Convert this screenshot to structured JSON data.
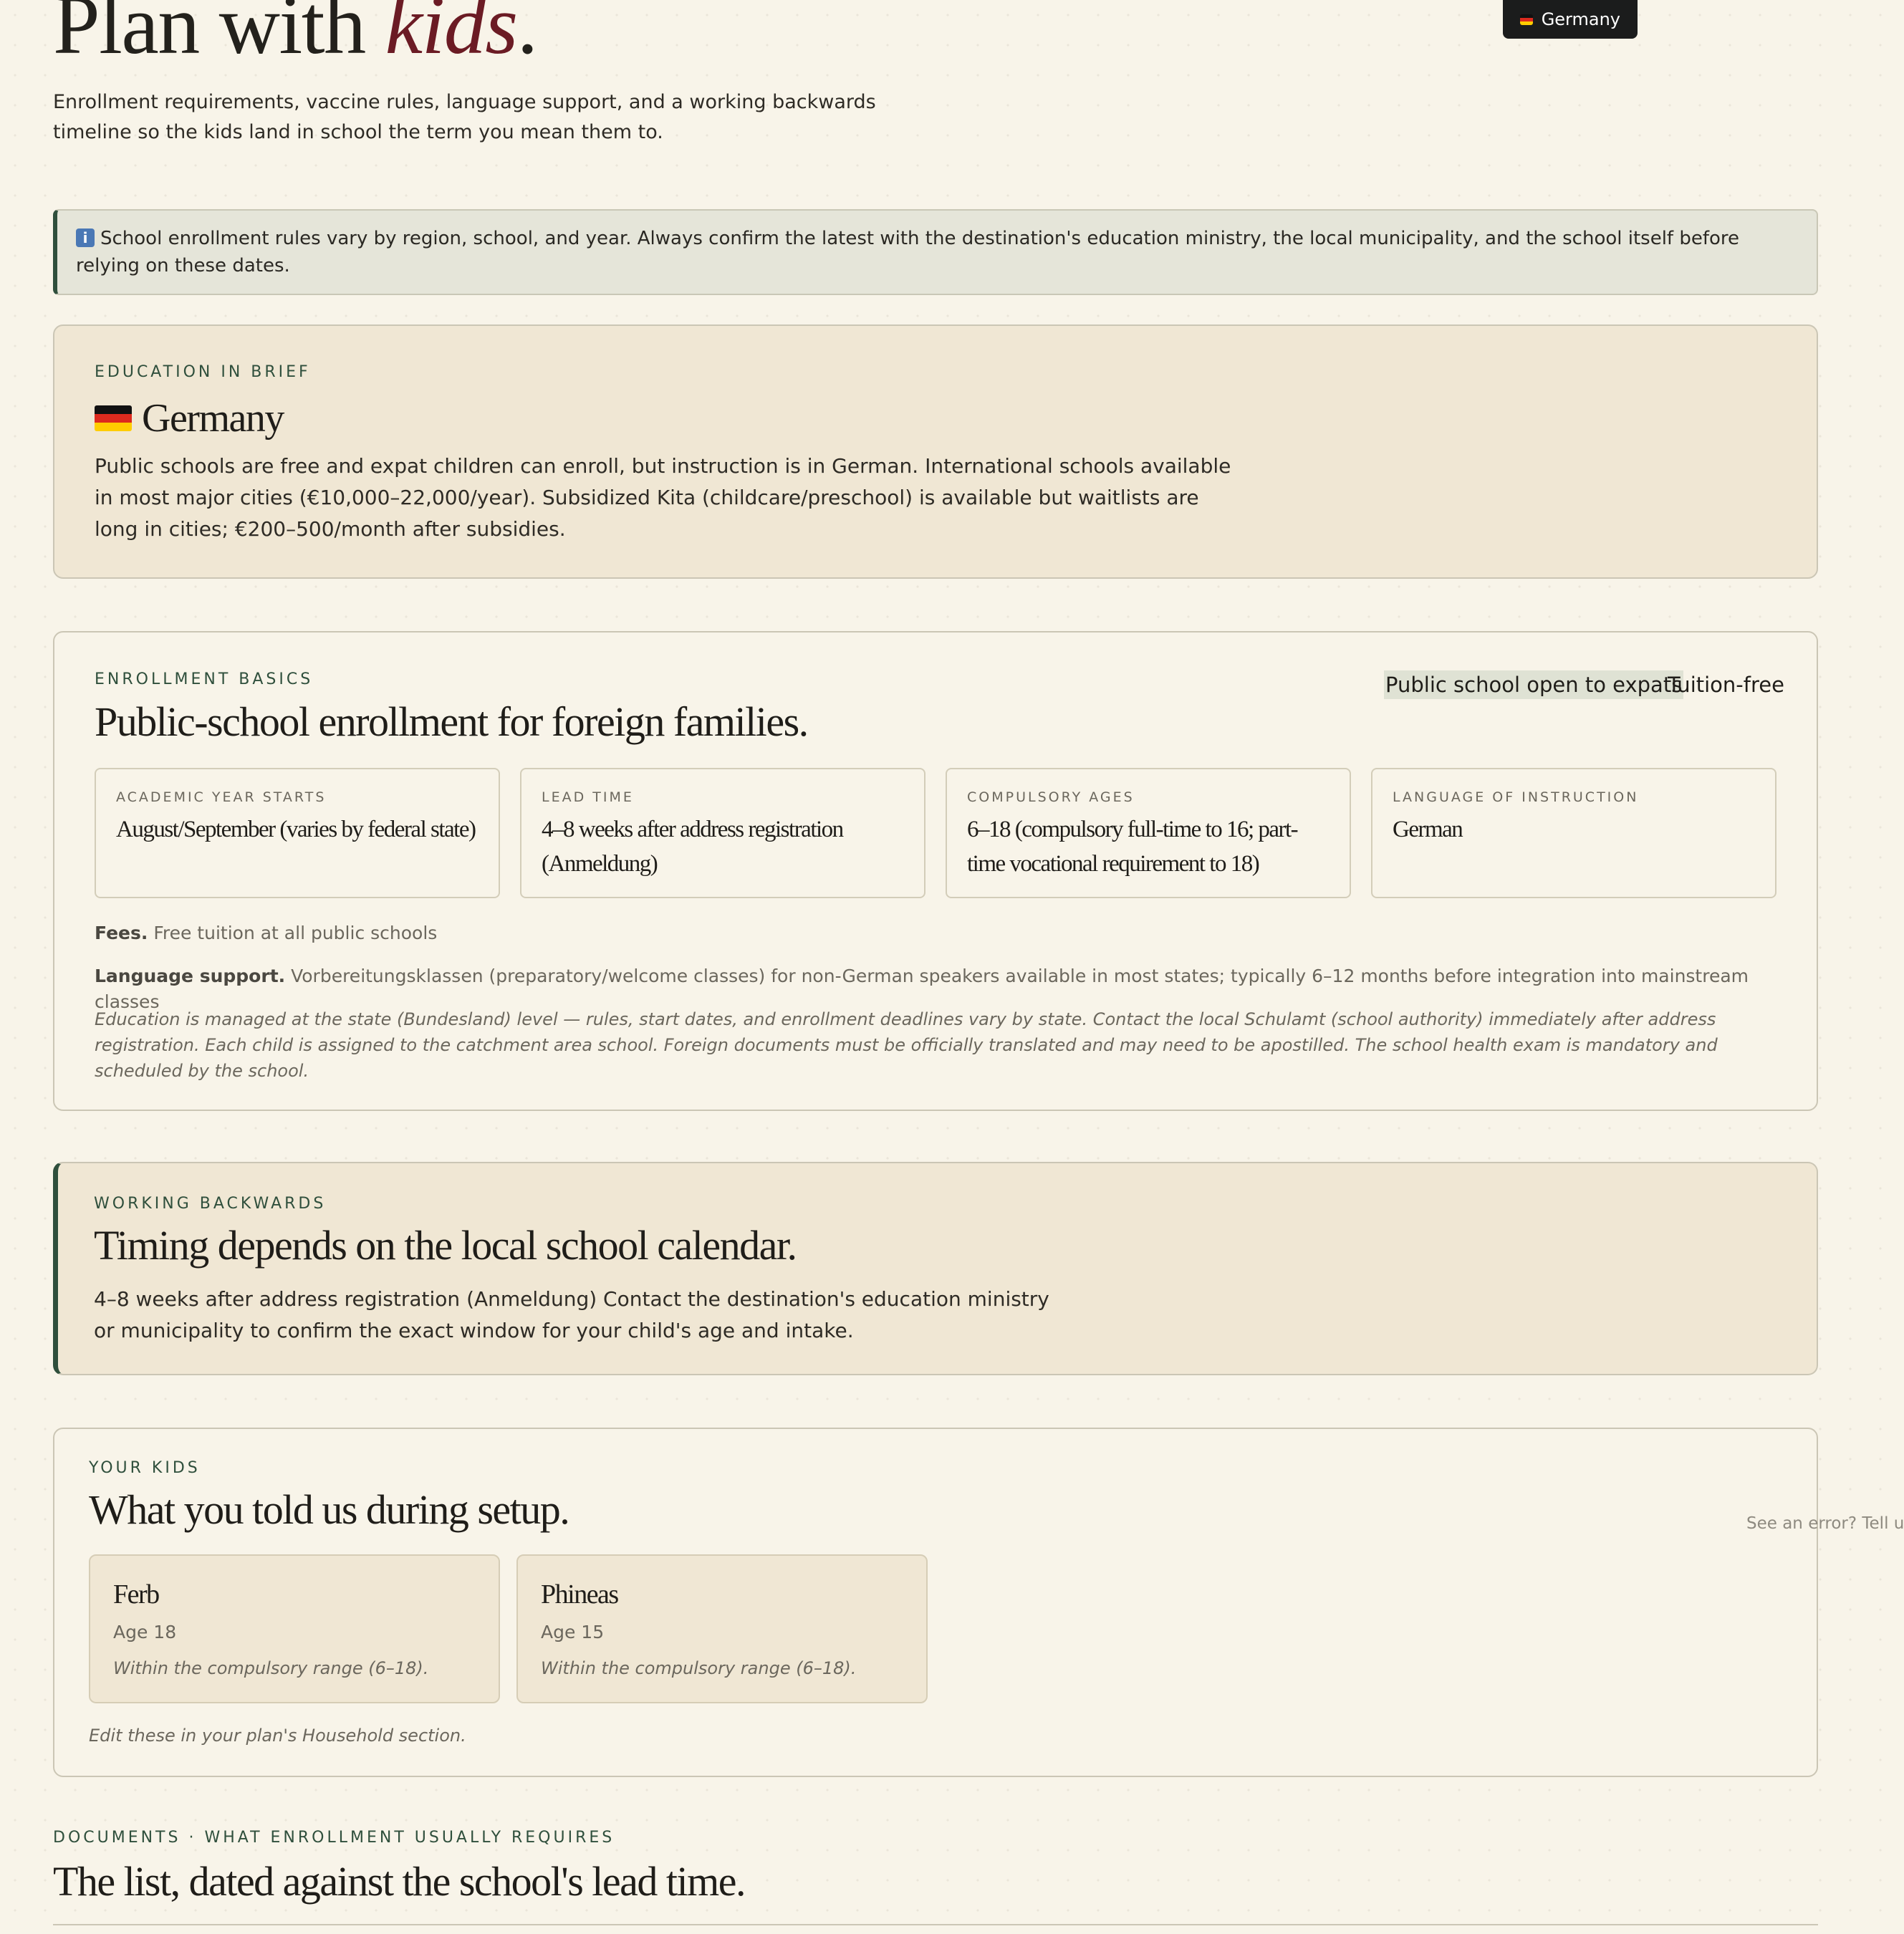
{
  "header": {
    "title_plain": "Plan with",
    "title_accent": "kids",
    "title_end": ".",
    "lede": "Enrollment requirements, vaccine rules, language support, and a working backwards timeline so the kids land in school the term you mean them to.",
    "country_selector": {
      "label": "Germany",
      "flag_icon": "germany-flag-icon"
    }
  },
  "notice": {
    "icon": "info-icon",
    "icon_glyph": "i",
    "text": "School enrollment rules vary by region, school, and year. Always confirm the latest with the destination's education ministry, the local municipality, and the school itself before relying on these dates."
  },
  "brief": {
    "eyebrow": "EDUCATION IN BRIEF",
    "country": "Germany",
    "body": "Public schools are free and expat children can enroll, but instruction is in German. International schools available in most major cities (€10,000–22,000/year). Subsidized Kita (childcare/preschool) is available but waitlists are long in cities; €200–500/month after subsidies."
  },
  "enrollment": {
    "eyebrow": "ENROLLMENT BASICS",
    "title": "Public-school enrollment for foreign families.",
    "tags": [
      "Public school open to expats",
      "Tuition-free"
    ],
    "stats": [
      {
        "label": "ACADEMIC YEAR STARTS",
        "value": "August/September (varies by federal state)"
      },
      {
        "label": "LEAD TIME",
        "value": "4–8 weeks after address registration (Anmeldung)"
      },
      {
        "label": "COMPULSORY AGES",
        "value": "6–18 (compulsory full-time to 16; part-time vocational requirement to 18)"
      },
      {
        "label": "LANGUAGE OF INSTRUCTION",
        "value": "German"
      }
    ],
    "fees_label": "Fees.",
    "fees_text": "Free tuition at all public schools",
    "language_label": "Language support.",
    "language_text": "Vorbereitungsklassen (preparatory/welcome classes) for non-German speakers available in most states; typically 6–12 months before integration into mainstream classes",
    "note": "Education is managed at the state (Bundesland) level — rules, start dates, and enrollment deadlines vary by state. Contact the local Schulamt (school authority) immediately after address registration. Each child is assigned to the catchment area school. Foreign documents must be officially translated and may need to be apostilled. The school health exam is mandatory and scheduled by the school."
  },
  "working_backwards": {
    "eyebrow": "WORKING BACKWARDS",
    "title": "Timing depends on the local school calendar.",
    "body": "4–8 weeks after address registration (Anmeldung) Contact the destination's education ministry or municipality to confirm the exact window for your child's age and intake."
  },
  "kids": {
    "eyebrow": "YOUR KIDS",
    "title": "What you told us during setup.",
    "children": [
      {
        "name": "Ferb",
        "age": "Age 18",
        "note": "Within the compulsory range (6–18)."
      },
      {
        "name": "Phineas",
        "age": "Age 15",
        "note": "Within the compulsory range (6–18)."
      }
    ],
    "footer": "Edit these in your plan's Household section."
  },
  "feedback_link": "See an error? Tell us",
  "documents": {
    "eyebrow": "DOCUMENTS · WHAT ENROLLMENT USUALLY REQUIRES",
    "title": "The list, dated against the school's lead time."
  },
  "colors": {
    "background": "#f8f4e9",
    "card_tan": "#f0e7d4",
    "accent_green": "#2f4f3c",
    "accent_burgundy": "#6b1b24",
    "dark_pill": "#1b1c1c"
  }
}
